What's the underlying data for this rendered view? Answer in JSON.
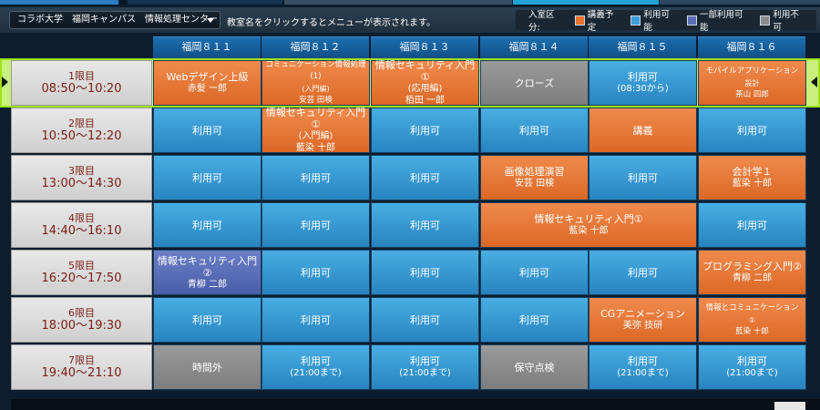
{
  "header": {
    "campus_select": "コラボ大学　福岡キャンパス　情報処理センター",
    "hint": "教室名をクリックするとメニューが表示されます。",
    "legend": {
      "title": "入室区分:",
      "items": [
        {
          "label": "講義予定",
          "color": "#e8742f"
        },
        {
          "label": "利用可能",
          "color": "#3d9dd8"
        },
        {
          "label": "一部利用可能",
          "color": "#5c6fb8"
        },
        {
          "label": "利用不可",
          "color": "#8a8a8a"
        }
      ]
    }
  },
  "rooms": [
    "福岡８１１",
    "福岡８１２",
    "福岡８１３",
    "福岡８１４",
    "福岡８１５",
    "福岡８１６"
  ],
  "periods": [
    {
      "name": "1限目",
      "time": "08:50〜10:20"
    },
    {
      "name": "2限目",
      "time": "10:50〜12:20"
    },
    {
      "name": "3限目",
      "time": "13:00〜14:30"
    },
    {
      "name": "4限目",
      "time": "14:40〜16:10"
    },
    {
      "name": "5限目",
      "time": "16:20〜17:50"
    },
    {
      "name": "6限目",
      "time": "18:00〜19:30"
    },
    {
      "name": "7限目",
      "time": "19:40〜21:10"
    }
  ],
  "schedule": [
    [
      {
        "type": "orange",
        "lines": [
          "Webデザイン上級",
          "赤髪 一郎"
        ]
      },
      {
        "type": "orange",
        "small": true,
        "lines": [
          "コミュニケーション情報処理(1)",
          "(入門編)",
          "安芸 田検"
        ]
      },
      {
        "type": "orange",
        "lines": [
          "情報セキュリティ入門①",
          "(応用編)",
          "栢田 一郎"
        ]
      },
      {
        "type": "gray",
        "lines": [
          "クローズ"
        ]
      },
      {
        "type": "blue",
        "lines": [
          "利用可",
          "(08:30から)"
        ]
      },
      {
        "type": "orange",
        "small": true,
        "lines": [
          "モバイルアプリケーション",
          "設計",
          "茶山 四郎"
        ]
      }
    ],
    [
      {
        "type": "blue",
        "lines": [
          "利用可"
        ]
      },
      {
        "type": "orange",
        "lines": [
          "情報セキュリティ入門①",
          "(入門編)",
          "藍染 十郎"
        ]
      },
      {
        "type": "blue",
        "lines": [
          "利用可"
        ]
      },
      {
        "type": "blue",
        "lines": [
          "利用可"
        ]
      },
      {
        "type": "orange",
        "lines": [
          "講義"
        ]
      },
      {
        "type": "blue",
        "lines": [
          "利用可"
        ]
      }
    ],
    [
      {
        "type": "blue",
        "lines": [
          "利用可"
        ]
      },
      {
        "type": "blue",
        "lines": [
          "利用可"
        ]
      },
      {
        "type": "blue",
        "lines": [
          "利用可"
        ]
      },
      {
        "type": "orange",
        "lines": [
          "画像処理演習",
          "安芸 田検"
        ]
      },
      {
        "type": "blue",
        "lines": [
          "利用可"
        ]
      },
      {
        "type": "orange",
        "lines": [
          "会計学１",
          "藍染 十郎"
        ]
      }
    ],
    [
      {
        "type": "blue",
        "lines": [
          "利用可"
        ]
      },
      {
        "type": "blue",
        "lines": [
          "利用可"
        ]
      },
      {
        "type": "blue",
        "lines": [
          "利用可"
        ]
      },
      {
        "type": "orange",
        "span": 2,
        "lines": [
          "情報セキュリティ入門①",
          "藍染 十郎"
        ]
      },
      {
        "type": "blue",
        "lines": [
          "利用可"
        ]
      }
    ],
    [
      {
        "type": "purple",
        "lines": [
          "情報セキュリティ入門②",
          "青柳 二郎"
        ]
      },
      {
        "type": "blue",
        "lines": [
          "利用可"
        ]
      },
      {
        "type": "blue",
        "lines": [
          "利用可"
        ]
      },
      {
        "type": "blue",
        "lines": [
          "利用可"
        ]
      },
      {
        "type": "blue",
        "lines": [
          "利用可"
        ]
      },
      {
        "type": "orange",
        "lines": [
          "プログラミング入門②",
          "青柳 二郎"
        ]
      }
    ],
    [
      {
        "type": "blue",
        "lines": [
          "利用可"
        ]
      },
      {
        "type": "blue",
        "lines": [
          "利用可"
        ]
      },
      {
        "type": "blue",
        "lines": [
          "利用可"
        ]
      },
      {
        "type": "blue",
        "lines": [
          "利用可"
        ]
      },
      {
        "type": "orange",
        "lines": [
          "CGアニメーション",
          "美弥 技研"
        ]
      },
      {
        "type": "orange",
        "small": true,
        "lines": [
          "情報とコミュニケーション",
          "①",
          "藍染 十郎"
        ]
      }
    ],
    [
      {
        "type": "gray",
        "lines": [
          "時間外"
        ]
      },
      {
        "type": "blue",
        "lines": [
          "利用可",
          "(21:00まで)"
        ]
      },
      {
        "type": "blue",
        "lines": [
          "利用可",
          "(21:00まで)"
        ]
      },
      {
        "type": "gray",
        "lines": [
          "保守点検"
        ]
      },
      {
        "type": "blue",
        "lines": [
          "利用可",
          "(21:00まで)"
        ]
      },
      {
        "type": "blue",
        "lines": [
          "利用可",
          "(21:00まで)"
        ]
      }
    ]
  ]
}
